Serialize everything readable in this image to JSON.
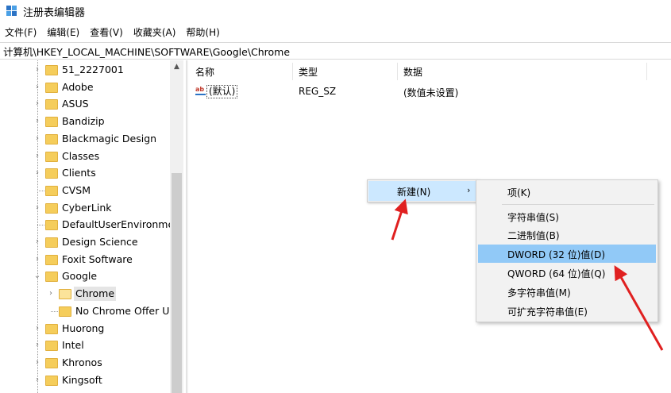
{
  "window": {
    "title": "注册表编辑器"
  },
  "menu": [
    "文件(F)",
    "编辑(E)",
    "查看(V)",
    "收藏夹(A)",
    "帮助(H)"
  ],
  "address": "计算机\\HKEY_LOCAL_MACHINE\\SOFTWARE\\Google\\Chrome",
  "tree": {
    "items": [
      {
        "label": "51_2227001",
        "expandable": true
      },
      {
        "label": "Adobe",
        "expandable": true
      },
      {
        "label": "ASUS",
        "expandable": true
      },
      {
        "label": "Bandizip",
        "expandable": true
      },
      {
        "label": "Blackmagic Design",
        "expandable": true
      },
      {
        "label": "Classes",
        "expandable": true
      },
      {
        "label": "Clients",
        "expandable": true
      },
      {
        "label": "CVSM",
        "expandable": false
      },
      {
        "label": "CyberLink",
        "expandable": true
      },
      {
        "label": "DefaultUserEnvironme",
        "expandable": false
      },
      {
        "label": "Design Science",
        "expandable": true
      },
      {
        "label": "Foxit Software",
        "expandable": true
      },
      {
        "label": "Google",
        "expandable": true,
        "expanded": true
      },
      {
        "label": "Chrome",
        "expandable": true,
        "child": true,
        "selected": true
      },
      {
        "label": "No Chrome Offer U",
        "expandable": false,
        "child": true
      },
      {
        "label": "Huorong",
        "expandable": true
      },
      {
        "label": "Intel",
        "expandable": true
      },
      {
        "label": "Khronos",
        "expandable": true
      },
      {
        "label": "Kingsoft",
        "expandable": true
      }
    ]
  },
  "list": {
    "headers": {
      "name": "名称",
      "type": "类型",
      "data": "数据"
    },
    "rows": [
      {
        "name": "(默认)",
        "type": "REG_SZ",
        "data": "(数值未设置)"
      }
    ]
  },
  "context_menu": {
    "new_label": "新建(N)",
    "submenu_arrow": "›",
    "submenu": [
      "项(K)",
      "字符串值(S)",
      "二进制值(B)",
      "DWORD (32 位)值(D)",
      "QWORD (64 位)值(Q)",
      "多字符串值(M)",
      "可扩充字符串值(E)"
    ],
    "highlighted_index": 3
  },
  "colors": {
    "menu_highlight": "#cce8ff",
    "submenu_hover": "#91c9f7",
    "arrow": "#e02020",
    "folder": "#f5cd5b"
  }
}
